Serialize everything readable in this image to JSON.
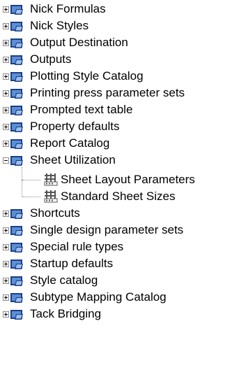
{
  "tree": {
    "items": [
      {
        "label": "Nick Formulas",
        "state": "collapsed"
      },
      {
        "label": "Nick Styles",
        "state": "collapsed"
      },
      {
        "label": "Output Destination",
        "state": "collapsed"
      },
      {
        "label": "Outputs",
        "state": "collapsed"
      },
      {
        "label": "Plotting Style Catalog",
        "state": "collapsed"
      },
      {
        "label": "Printing press parameter sets",
        "state": "collapsed"
      },
      {
        "label": "Prompted text table",
        "state": "collapsed"
      },
      {
        "label": "Property defaults",
        "state": "collapsed"
      },
      {
        "label": "Report Catalog",
        "state": "collapsed"
      },
      {
        "label": "Sheet Utilization",
        "state": "expanded",
        "children": [
          {
            "label": "Sheet Layout Parameters"
          },
          {
            "label": "Standard Sheet Sizes"
          }
        ]
      },
      {
        "label": "Shortcuts",
        "state": "collapsed"
      },
      {
        "label": "Single design parameter sets",
        "state": "collapsed"
      },
      {
        "label": "Special rule types",
        "state": "collapsed"
      },
      {
        "label": "Startup defaults",
        "state": "collapsed"
      },
      {
        "label": "Style catalog",
        "state": "collapsed"
      },
      {
        "label": "Subtype Mapping Catalog",
        "state": "collapsed"
      },
      {
        "label": "Tack Bridging",
        "state": "collapsed"
      }
    ]
  },
  "icons": {
    "folder": "settings-folder-icon",
    "child": "sheet-parameters-icon",
    "expander_collapsed": "plus-expander-icon",
    "expander_expanded": "minus-expander-icon"
  },
  "colors": {
    "folder_dark": "#1c3f86",
    "folder_light": "#5b8fd6",
    "child_icon": "#555555"
  }
}
